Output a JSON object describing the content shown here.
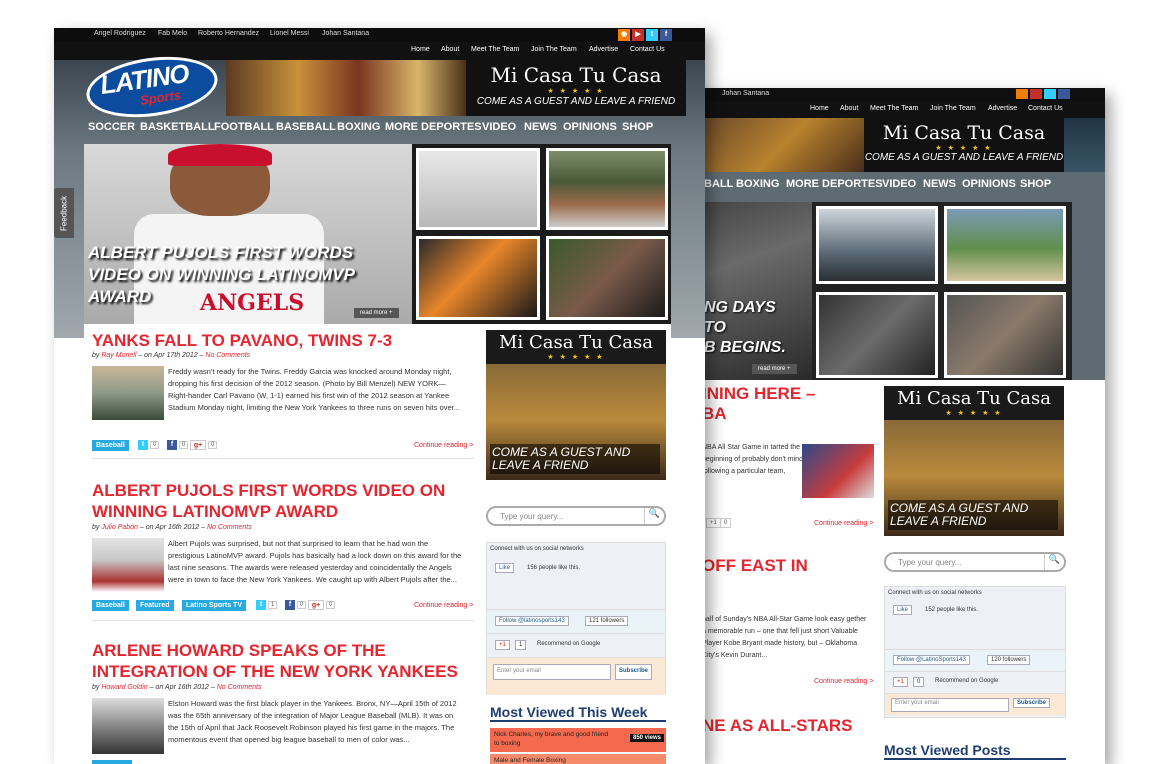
{
  "back_page": {
    "topbar": {
      "names": [
        "Johan Santana"
      ]
    },
    "topnav": [
      "Home",
      "About",
      "Meet The Team",
      "Join The Team",
      "Advertise",
      "Contact Us"
    ],
    "banner": {
      "title": "Mi Casa Tu Casa",
      "stars": "★ ★ ★ ★ ★",
      "tagline": "COME AS A GUEST AND LEAVE A FRIEND"
    },
    "nav": [
      "BALL",
      "BOXING",
      "MORE DEPORTES",
      "VIDEO",
      "NEWS",
      "OPINIONS",
      "SHOP"
    ],
    "hero": {
      "title_lines": [
        "NG DAYS",
        "TO",
        "B BEGINS."
      ],
      "read_more": "read more +"
    },
    "articles": [
      {
        "title_lines": [
          "INING HERE –",
          "BA"
        ],
        "excerpt": "NBA All Star Game in tarted the beginning of probably don't mind following a particular team,",
        "continue": "Continue reading >",
        "share_count": "0"
      },
      {
        "title_lines": [
          "OFF EAST IN"
        ],
        "excerpt": "half of Sunday's NBA All-Star Game look easy gether a memorable run – one that fell just short Valuable Player Kobe Bryant made history, but – Oklahoma City's Kevin Durant...",
        "continue": "Continue reading >"
      },
      {
        "title_lines": [
          "NE AS ALL-STARS"
        ]
      }
    ],
    "ad": {
      "title": "Mi Casa Tu Casa",
      "stars": "★ ★ ★ ★ ★",
      "caption": "COME AS A GUEST AND LEAVE A FRIEND"
    },
    "search": {
      "placeholder": "Type your query...",
      "button": "🔍"
    },
    "social": {
      "heading": "Connect with us on social networks",
      "like_label": "Like",
      "likes_text": "152 people like this.",
      "follow_label": "Follow @LatinoSports143",
      "followers": "120 followers",
      "gplus_label": "+1",
      "gplus_count": "0",
      "recommend": "Recommend on Google",
      "email_placeholder": "Enter your email",
      "subscribe": "Subscribe"
    },
    "most_viewed_heading": "Most Viewed Posts"
  },
  "front_page": {
    "topbar": {
      "names": [
        "Angel Rodriguez",
        "Fab Melo",
        "Roberto Hernandez",
        "Lionel Messi",
        "Johan Santana"
      ]
    },
    "social_icons": [
      "rss-icon",
      "youtube-icon",
      "twitter-icon",
      "facebook-icon"
    ],
    "topnav": [
      "Home",
      "About",
      "Meet The Team",
      "Join The Team",
      "Advertise",
      "Contact Us"
    ],
    "logo": {
      "main": "LATINO",
      "sub": "Sports"
    },
    "banner": {
      "title": "Mi Casa Tu Casa",
      "stars": "★ ★ ★ ★ ★",
      "tagline": "COME AS A GUEST AND LEAVE A FRIEND"
    },
    "nav": [
      "SOCCER",
      "BASKETBALL",
      "FOOTBALL",
      "BASEBALL",
      "BOXING",
      "MORE DEPORTES",
      "VIDEO",
      "NEWS",
      "OPINIONS",
      "SHOP"
    ],
    "hero": {
      "title": "ALBERT PUJOLS FIRST WORDS VIDEO ON WINNING LATINOMVP AWARD",
      "read_more": "read more +",
      "jersey": "ANGELS"
    },
    "articles": [
      {
        "title": "YANKS FALL TO PAVANO, TWINS 7-3",
        "by": "by",
        "author": "Ray Monell",
        "date": "– on Apr 17th 2012 –",
        "comments": "No Comments",
        "excerpt": "Freddy wasn't ready for the Twins. Freddy Garcia was knocked around Monday night, dropping his first decision of the 2012 season. (Photo by Bill Menzel) NEW YORK—Right-hander Carl Pavano (W, 1-1) earned his first win of the 2012 season at Yankee Stadium Monday night, limiting the New York Yankees to three runs on seven hits over...",
        "categories": [
          "Baseball"
        ],
        "shares": {
          "twitter": "0",
          "facebook": "0",
          "gplus": "0"
        },
        "continue": "Continue reading >"
      },
      {
        "title": "ALBERT PUJOLS FIRST WORDS VIDEO ON WINNING LATINOMVP AWARD",
        "by": "by",
        "author": "Julio Pabón",
        "date": "– on Apr 16th 2012 –",
        "comments": "No Comments",
        "excerpt": "Albert Pujols was surprised, but not that surprised to learn that he had won the prestigious LatinoMVP award. Pujols has basically had a lock down on this award for the last nine seasons. The awards were released yesterday and coincidentally the Angels were in town to face the New York Yankees. We caught up with Albert Pujols after the...",
        "categories": [
          "Baseball",
          "Featured",
          "Latino Sports TV"
        ],
        "shares": {
          "twitter": "1",
          "facebook": "0",
          "gplus": "0"
        },
        "continue": "Continue reading >"
      },
      {
        "title": "ARLENE HOWARD SPEAKS OF THE INTEGRATION OF THE NEW YORK YANKEES",
        "by": "by",
        "author": "Howard Goldin",
        "date": "– on Apr 16th 2012 –",
        "comments": "No Comments",
        "excerpt": "Elston Howard was the first black player in the Yankees. Bronx, NY—April 15th of 2012 was the 65th anniversary of the integration of Major League Baseball (MLB). It was on the 15th of April that Jack Roosevelt Robinson played his first game in the majors. The momentous event that opened big league baseball to men of color was..."
      }
    ],
    "ad": {
      "title": "Mi Casa Tu Casa",
      "stars": "★ ★ ★ ★ ★",
      "caption": "COME AS A GUEST AND LEAVE A FRIEND"
    },
    "search": {
      "placeholder": "Type your query...",
      "button": "🔍"
    },
    "social": {
      "heading": "Connect with us on social networks",
      "like_label": "Like",
      "likes_text": "156 people like this.",
      "follow_label": "Follow @latinosports143",
      "followers": "121 followers",
      "gplus_label": "+1",
      "gplus_count": "1",
      "recommend": "Recommend on Google",
      "email_placeholder": "Enter your email",
      "subscribe": "Subscribe"
    },
    "most_viewed": {
      "heading": "Most Viewed This Week",
      "items": [
        {
          "title": "Nick Charles, my brave and good friend to boxing",
          "views": "850 views"
        },
        {
          "title": "Male and Female Boxing",
          "views": ""
        }
      ]
    }
  },
  "feedback_tab": "Feedback",
  "colors": {
    "accent_red": "#e3262f",
    "category_blue": "#27a9e1",
    "heading_navy": "#1e3e73",
    "star_gold": "#f1c40f"
  }
}
